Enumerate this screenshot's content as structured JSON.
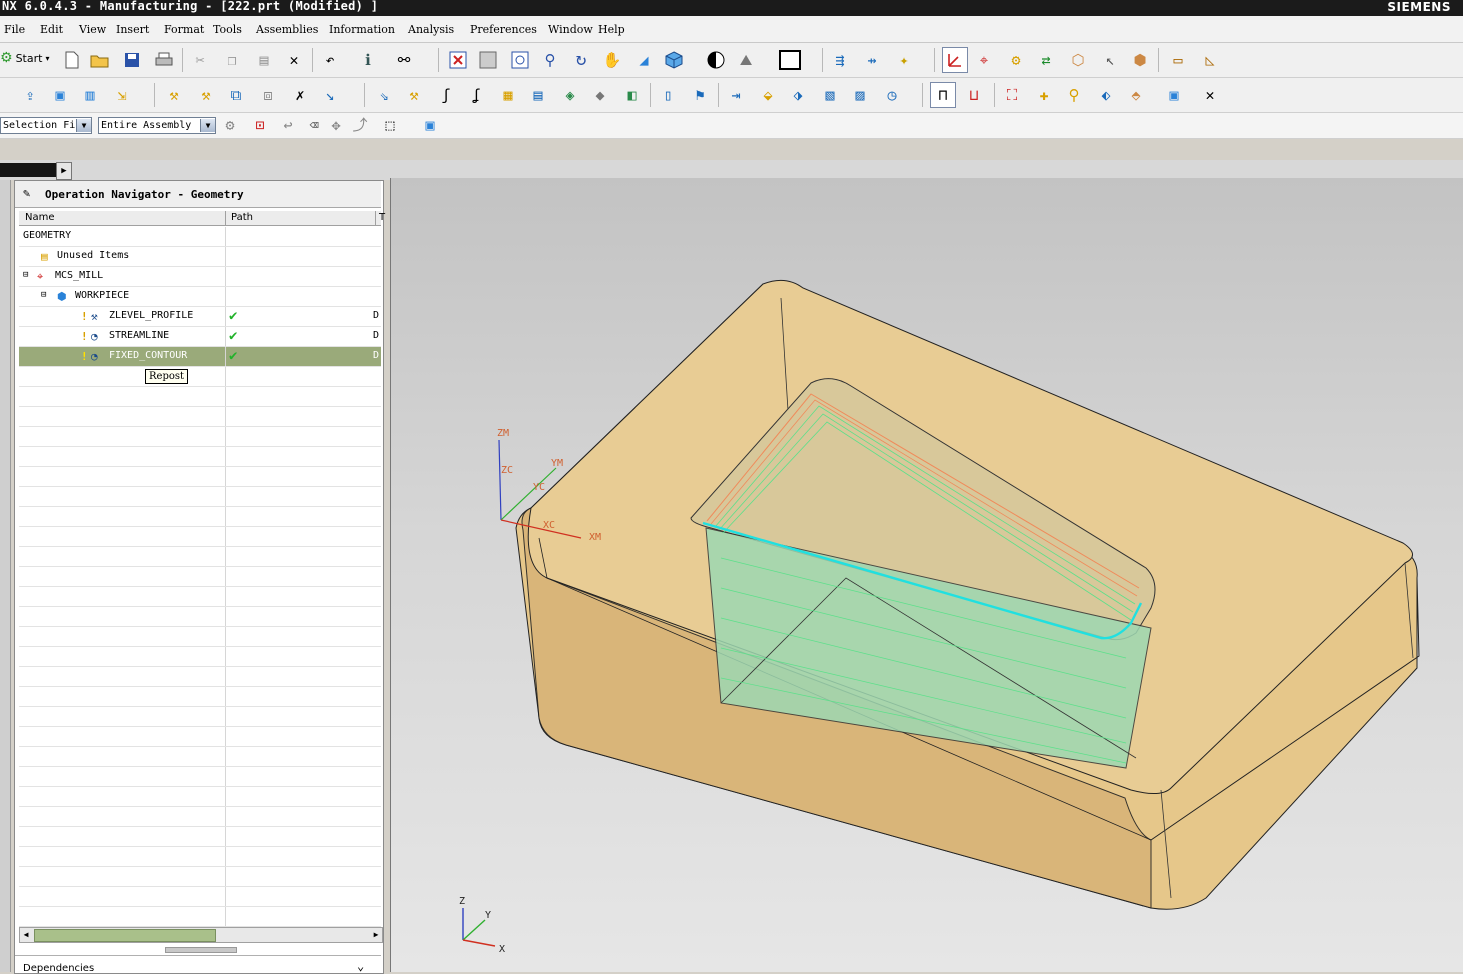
{
  "window": {
    "title": "NX 6.0.4.3 - Manufacturing - [222.prt (Modified) ]",
    "brand": "SIEMENS"
  },
  "menu": [
    "File",
    "Edit",
    "View",
    "Insert",
    "Format",
    "Tools",
    "Assemblies",
    "Information",
    "Analysis",
    "Preferences",
    "Window",
    "Help"
  ],
  "toolbar": {
    "start_label": "Start"
  },
  "selection": {
    "filter": "Selection Fi",
    "scope": "Entire Assembly"
  },
  "navigator": {
    "title": "Operation Navigator - Geometry",
    "columns": {
      "name": "Name",
      "path": "Path",
      "extra": "T"
    },
    "rows": [
      {
        "label": "GEOMETRY",
        "level": 0,
        "check": "",
        "extra": ""
      },
      {
        "label": "Unused Items",
        "level": 1,
        "check": "",
        "extra": ""
      },
      {
        "label": "MCS_MILL",
        "level": 1,
        "check": "",
        "extra": ""
      },
      {
        "label": "WORKPIECE",
        "level": 2,
        "check": "",
        "extra": ""
      },
      {
        "label": "ZLEVEL_PROFILE",
        "level": 3,
        "check": "✔",
        "extra": "D"
      },
      {
        "label": "STREAMLINE",
        "level": 3,
        "check": "✔",
        "extra": "D"
      },
      {
        "label": "FIXED_CONTOUR",
        "level": 3,
        "check": "✔",
        "extra": "D"
      }
    ],
    "tooltip": "Repost",
    "dependencies": "Dependencies"
  },
  "viewport": {
    "csys_work": {
      "zm": "ZM",
      "ym": "YM",
      "xm": "XM",
      "zc": "ZC",
      "yc": "YC",
      "xc": "XC"
    },
    "csys_abs": {
      "z": "Z",
      "y": "Y",
      "x": "X"
    }
  },
  "colors": {
    "part_fill": "#e8c888",
    "toolpath_green": "#5be08a",
    "toolpath_cyan": "#20e0e0",
    "toolpath_orange": "#f08a5a",
    "selection": "#9aaa7a"
  }
}
